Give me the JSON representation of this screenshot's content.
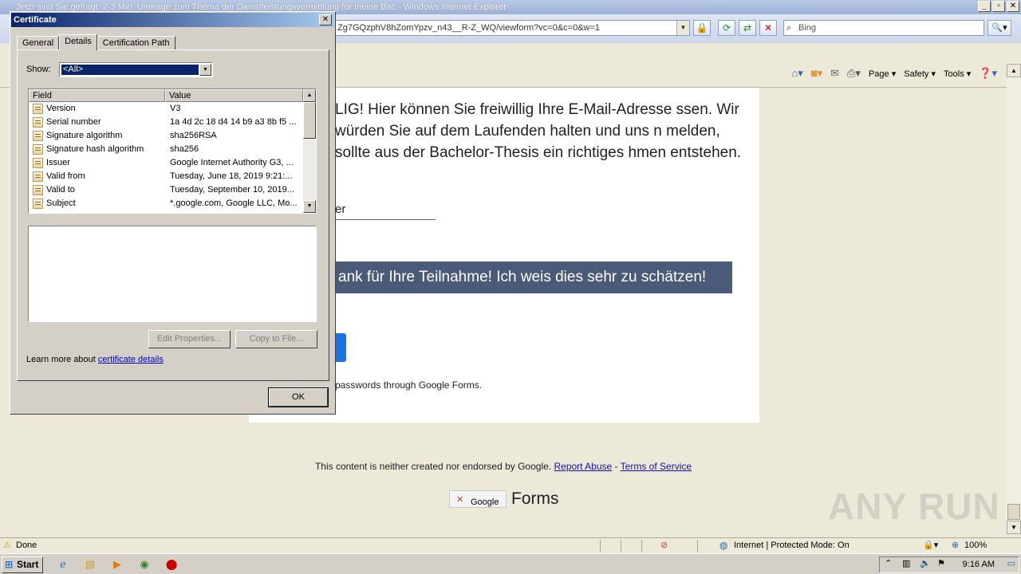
{
  "ie": {
    "title": "Jetzt sind Sie gefragt: 2-3 Min. Umfrage zum Thema der Dienstleistungsvermittlung für meine Bac - Windows Internet Explorer",
    "address": "Zg7GQzphV8hZomYpzv_n43__R-Z_WQ/viewform?vc=0&c=0&w=1",
    "search_placeholder": "Bing",
    "menu": {
      "page": "Page",
      "safety": "Safety",
      "tools": "Tools"
    }
  },
  "form": {
    "paragraph": "LIG! Hier können Sie freiwillig Ihre E-Mail-Adresse ssen. Wir würden Sie auf dem Laufenden halten und uns n melden, sollte aus der Bachelor-Thesis ein richtiges hmen entstehen.",
    "answer_fragment": "er",
    "thanks_text": "ank für Ihre Teilnahme! Ich weis dies sehr zu schätzen!",
    "password_note": "passwords through Google Forms.",
    "footer_text": "This content is neither created nor endorsed by Google.",
    "report_abuse": "Report Abuse",
    "terms": "Terms of Service",
    "footer_sep": "-",
    "logo_google": "Google",
    "logo_forms": "Forms"
  },
  "watermark": "ANY RUN",
  "status": {
    "text": "Done",
    "zone": "Internet | Protected Mode: On",
    "zoom": "100%"
  },
  "taskbar": {
    "start": "Start",
    "clock": "9:16 AM"
  },
  "dialog": {
    "title": "Certificate",
    "close": "✕",
    "tabs": [
      {
        "label": "General"
      },
      {
        "label": "Details"
      },
      {
        "label": "Certification Path"
      }
    ],
    "show_label": "Show:",
    "show_value": "<All>",
    "columns": {
      "field": "Field",
      "value": "Value"
    },
    "rows": [
      {
        "field": "Version",
        "value": "V3"
      },
      {
        "field": "Serial number",
        "value": "1a 4d 2c 18 d4 14 b9 a3 8b f5 ..."
      },
      {
        "field": "Signature algorithm",
        "value": "sha256RSA"
      },
      {
        "field": "Signature hash algorithm",
        "value": "sha256"
      },
      {
        "field": "Issuer",
        "value": "Google Internet Authority G3, ..."
      },
      {
        "field": "Valid from",
        "value": "Tuesday, June 18, 2019 9:21:..."
      },
      {
        "field": "Valid to",
        "value": "Tuesday, September 10, 2019..."
      },
      {
        "field": "Subject",
        "value": "*.google.com, Google LLC, Mo..."
      }
    ],
    "edit_properties": "Edit Properties...",
    "copy_to_file": "Copy to File...",
    "learn_prefix": "Learn more about",
    "learn_link": "certificate details",
    "ok": "OK"
  }
}
